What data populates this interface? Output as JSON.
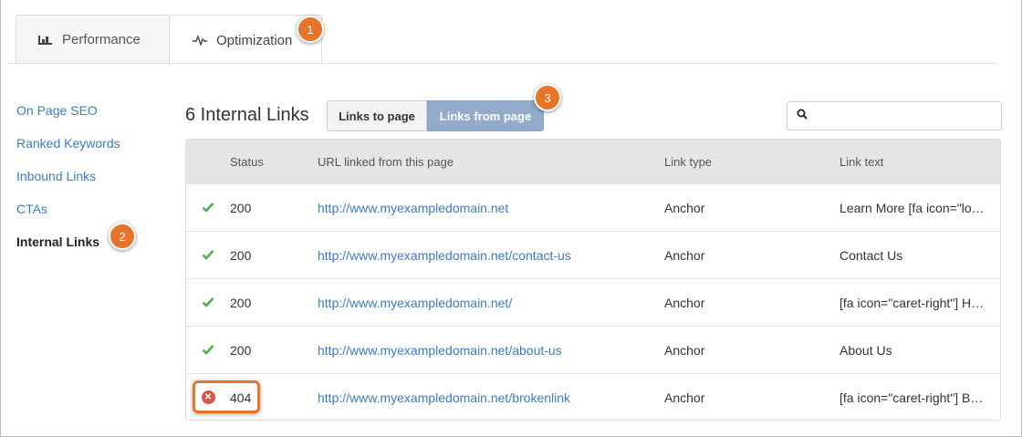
{
  "tabs": [
    {
      "label": "Performance",
      "icon": "bar-chart-icon"
    },
    {
      "label": "Optimization",
      "icon": "activity-pulse-icon"
    }
  ],
  "callouts": [
    "1",
    "2",
    "3"
  ],
  "sidebar": {
    "items": [
      {
        "label": "On Page SEO"
      },
      {
        "label": "Ranked Keywords"
      },
      {
        "label": "Inbound Links"
      },
      {
        "label": "CTAs"
      },
      {
        "label": "Internal Links",
        "active": true
      }
    ]
  },
  "main": {
    "heading": "6 Internal Links",
    "toggle": {
      "links_to": "Links to page",
      "links_from": "Links from page",
      "selected": "Links from page"
    },
    "search": {
      "placeholder": "",
      "value": "",
      "icon": "search-icon"
    },
    "table": {
      "columns": [
        "Status",
        "URL linked from this page",
        "Link type",
        "Link text"
      ],
      "rows": [
        {
          "ok": true,
          "status": "200",
          "url": "http://www.myexampledomain.net",
          "type": "Anchor",
          "text": "Learn More [fa icon=\"lo…"
        },
        {
          "ok": true,
          "status": "200",
          "url": "http://www.myexampledomain.net/contact-us",
          "type": "Anchor",
          "text": "Contact Us"
        },
        {
          "ok": true,
          "status": "200",
          "url": "http://www.myexampledomain.net/",
          "type": "Anchor",
          "text": "[fa icon=\"caret-right\"] H…"
        },
        {
          "ok": true,
          "status": "200",
          "url": "http://www.myexampledomain.net/about-us",
          "type": "Anchor",
          "text": "About Us"
        },
        {
          "ok": false,
          "status": "404",
          "url": "http://www.myexampledomain.net/brokenlink",
          "type": "Anchor",
          "text": "[fa icon=\"caret-right\"] B…"
        }
      ]
    }
  },
  "colors": {
    "accent": "#e8742a",
    "link": "#3a7cc5",
    "ok": "#4cae4c",
    "error": "#d9534f",
    "selected_toggle": "#93abcb"
  }
}
